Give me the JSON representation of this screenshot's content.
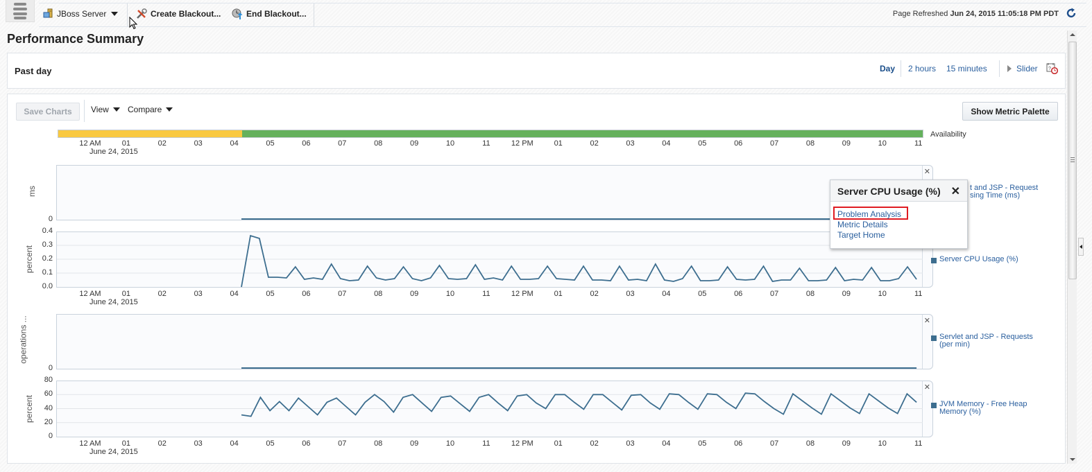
{
  "toolbar": {
    "target_menu": "JBoss Server",
    "create_blackout": "Create Blackout...",
    "end_blackout": "End Blackout...",
    "page_refreshed_label": "Page Refreshed",
    "page_refreshed_value": "Jun 24, 2015 11:05:18 PM PDT"
  },
  "page": {
    "title": "Performance Summary"
  },
  "time_range": {
    "label": "Past day",
    "options": [
      "Day",
      "2 hours",
      "15 minutes"
    ],
    "selected": "Day",
    "slider_label": "Slider"
  },
  "controls": {
    "save_charts": "Save Charts",
    "view": "View",
    "compare": "Compare",
    "show_metric_palette": "Show Metric Palette"
  },
  "popup": {
    "title": "Server CPU Usage (%)",
    "links": [
      "Problem Analysis",
      "Metric Details",
      "Target Home"
    ],
    "highlighted": "Problem Analysis"
  },
  "colors": {
    "availability_down": "#f9c940",
    "availability_up": "#65b15c",
    "series_line": "#3d6e8f",
    "link": "#2a5f9e",
    "highlight_box": "#e01b22"
  },
  "chart_data": [
    {
      "type": "bar",
      "title": "Availability",
      "x_start": "12 AM June 24, 2015",
      "segments": [
        {
          "from_hour": -0.9,
          "to_hour": 4.2,
          "status": "unknown"
        },
        {
          "from_hour": 4.2,
          "to_hour": 23.0,
          "status": "up"
        }
      ],
      "xticks": [
        "12 AM",
        "01",
        "02",
        "03",
        "04",
        "05",
        "06",
        "07",
        "08",
        "09",
        "10",
        "11",
        "12 PM",
        "01",
        "02",
        "03",
        "04",
        "05",
        "06",
        "07",
        "08",
        "09",
        "10",
        "11"
      ],
      "date_label": "June 24, 2015"
    },
    {
      "type": "line",
      "title": "Servlet and JSP - Request Processing Time (ms)",
      "legend_visible": "t and JSP - Request\nsing Time (ms)",
      "ylabel": "ms",
      "yticks": [
        "0"
      ],
      "ylim": [
        0,
        1
      ],
      "series": [
        {
          "name": "Servlet and JSP - Request Processing Time (ms)",
          "start_hour": 4.2,
          "end_hour": 22.95,
          "constant": 0
        }
      ]
    },
    {
      "type": "line",
      "title": "Server CPU Usage (%)",
      "legend": "Server CPU Usage (%)",
      "ylabel": "percent",
      "yticks": [
        "0.0",
        "0.1",
        "0.2",
        "0.3",
        "0.4"
      ],
      "ylim": [
        0,
        0.4
      ],
      "grid": true,
      "x_start_hour": 4.2,
      "x_step_hours": 0.333,
      "series": [
        {
          "name": "Server CPU Usage (%)",
          "values": [
            0.0,
            0.37,
            0.35,
            0.07,
            0.07,
            0.065,
            0.145,
            0.055,
            0.065,
            0.055,
            0.165,
            0.06,
            0.045,
            0.05,
            0.15,
            0.065,
            0.05,
            0.06,
            0.145,
            0.06,
            0.045,
            0.065,
            0.155,
            0.06,
            0.055,
            0.06,
            0.16,
            0.055,
            0.065,
            0.05,
            0.15,
            0.055,
            0.055,
            0.06,
            0.15,
            0.06,
            0.055,
            0.05,
            0.15,
            0.05,
            0.05,
            0.045,
            0.15,
            0.05,
            0.055,
            0.045,
            0.165,
            0.05,
            0.04,
            0.06,
            0.15,
            0.045,
            0.045,
            0.05,
            0.145,
            0.055,
            0.05,
            0.055,
            0.15,
            0.04,
            0.05,
            0.05,
            0.135,
            0.045,
            0.045,
            0.05,
            0.14,
            0.045,
            0.055,
            0.05,
            0.14,
            0.045,
            0.045,
            0.06,
            0.145,
            0.055
          ]
        }
      ],
      "xticks": [
        "12 AM",
        "01",
        "02",
        "03",
        "04",
        "05",
        "06",
        "07",
        "08",
        "09",
        "10",
        "11",
        "12 PM",
        "01",
        "02",
        "03",
        "04",
        "05",
        "06",
        "07",
        "08",
        "09",
        "10",
        "11"
      ],
      "date_label": "June 24, 2015"
    },
    {
      "type": "line",
      "title": "Servlet and JSP - Requests (per min)",
      "legend": "Servlet and JSP - Requests (per min)",
      "ylabel": "operations ...",
      "yticks": [
        "0"
      ],
      "ylim": [
        0,
        1
      ],
      "series": [
        {
          "name": "Servlet and JSP - Requests (per min)",
          "start_hour": 4.2,
          "end_hour": 22.95,
          "constant": 0
        }
      ]
    },
    {
      "type": "line",
      "title": "JVM Memory - Free Heap Memory (%)",
      "legend": "JVM Memory - Free Heap Memory (%)",
      "ylabel": "percent",
      "yticks": [
        "0",
        "20",
        "40",
        "60",
        "80"
      ],
      "ylim": [
        0,
        80
      ],
      "grid": true,
      "x_start_hour": 4.2,
      "x_step_hours": 0.333,
      "series": [
        {
          "name": "JVM Memory - Free Heap Memory (%)",
          "values": [
            31,
            29,
            56,
            37,
            50,
            37,
            55,
            43,
            31,
            49,
            55,
            43,
            31,
            49,
            60,
            50,
            35,
            56,
            60,
            48,
            36,
            56,
            58,
            47,
            36,
            56,
            60,
            48,
            37,
            58,
            60,
            48,
            40,
            60,
            60,
            49,
            39,
            60,
            60,
            49,
            38,
            59,
            60,
            48,
            39,
            61,
            60,
            49,
            39,
            61,
            60,
            49,
            40,
            62,
            61,
            50,
            40,
            32,
            61,
            51,
            41,
            32,
            61,
            51,
            41,
            33,
            61,
            51,
            41,
            33,
            61,
            49
          ]
        }
      ],
      "xticks": [
        "12 AM",
        "01",
        "02",
        "03",
        "04",
        "05",
        "06",
        "07",
        "08",
        "09",
        "10",
        "11",
        "12 PM",
        "01",
        "02",
        "03",
        "04",
        "05",
        "06",
        "07",
        "08",
        "09",
        "10",
        "11"
      ],
      "date_label": "June 24, 2015"
    }
  ]
}
